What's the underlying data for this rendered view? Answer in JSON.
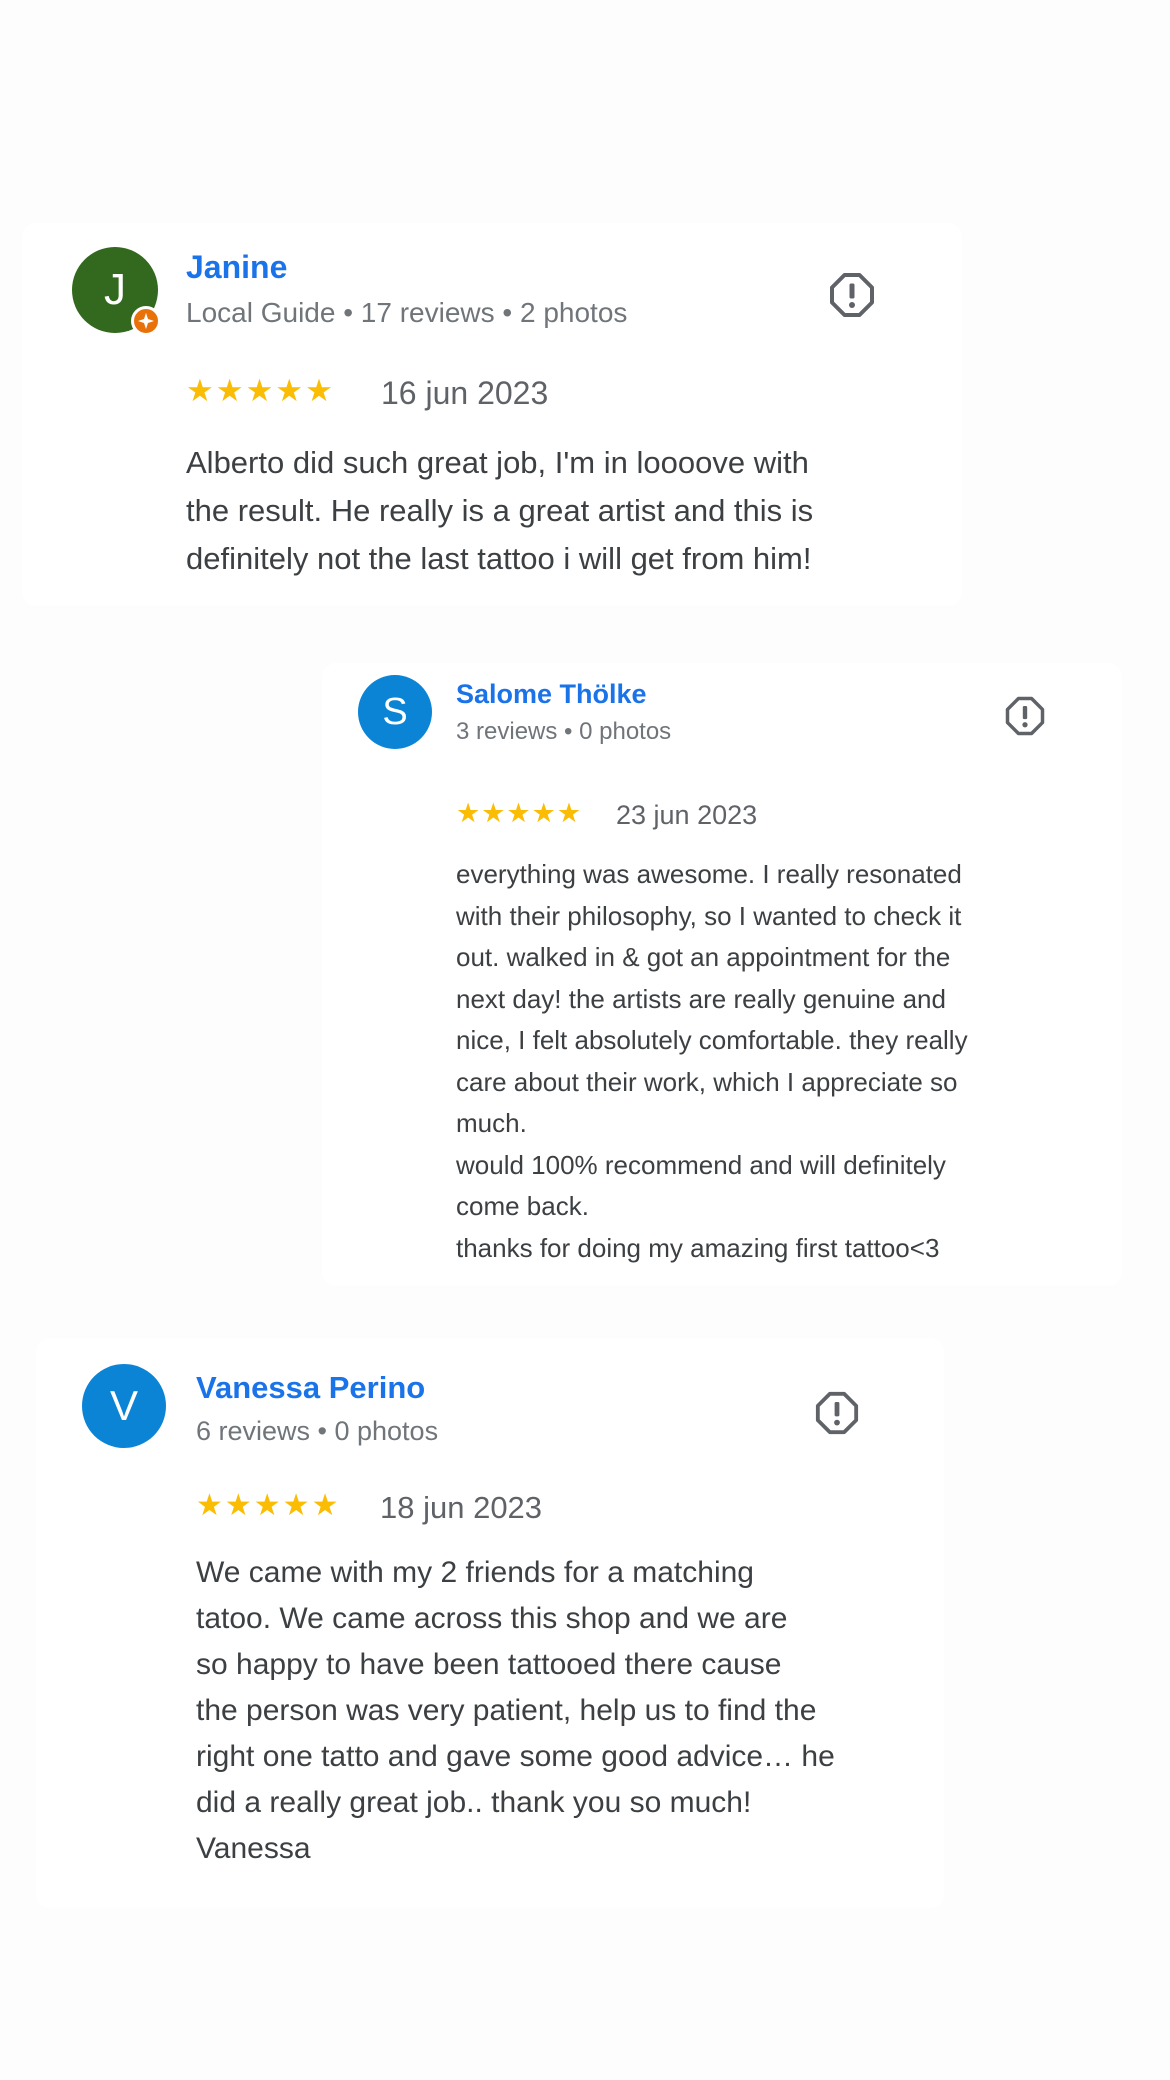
{
  "reviews": [
    {
      "initial": "J",
      "avatar_color": "#33691e",
      "is_local_guide": true,
      "name": "Janine",
      "meta": "Local Guide • 17 reviews • 2 photos",
      "rating": 5,
      "stars": "★★★★★",
      "date": "16 jun 2023",
      "text_lines": [
        "Alberto did such great job, I'm in loooove with",
        "the result. He really is a great artist and this is",
        "definitely not the last tattoo i will get from him!"
      ]
    },
    {
      "initial": "S",
      "avatar_color": "#0b84d6",
      "is_local_guide": false,
      "name": "Salome Thölke",
      "meta": "3 reviews • 0 photos",
      "rating": 5,
      "stars": "★★★★★",
      "date": "23 jun 2023",
      "text_lines": [
        "everything was awesome. I really resonated",
        "with their philosophy, so I wanted to check it",
        "out. walked in & got an appointment for the",
        "next day! the artists are really genuine and",
        "nice, I felt absolutely comfortable. they really",
        "care about their work, which I appreciate so",
        "much.",
        "would 100% recommend and will definitely",
        "come back.",
        "thanks for doing my amazing first tattoo<3"
      ]
    },
    {
      "initial": "V",
      "avatar_color": "#0b84d6",
      "is_local_guide": false,
      "name": "Vanessa Perino",
      "meta": "6 reviews • 0 photos",
      "rating": 5,
      "stars": "★★★★★",
      "date": "18 jun 2023",
      "text_lines": [
        "We came with my 2 friends for a matching",
        "tatoo. We came across this shop and we are",
        "so happy to have been tattooed there cause",
        "the person was very patient, help us to find the",
        "right one tatto and gave some good advice… he",
        "did a really great job.. thank you so much!",
        "Vanessa"
      ]
    }
  ],
  "icons": {
    "report": "report-octagon-icon",
    "local_guide": "local-guide-badge-icon",
    "star": "star-icon"
  },
  "colors": {
    "name_link": "#1a73e8",
    "star": "#fbbc04",
    "local_guide_badge": "#e8710a",
    "report_icon": "#5f6368"
  }
}
